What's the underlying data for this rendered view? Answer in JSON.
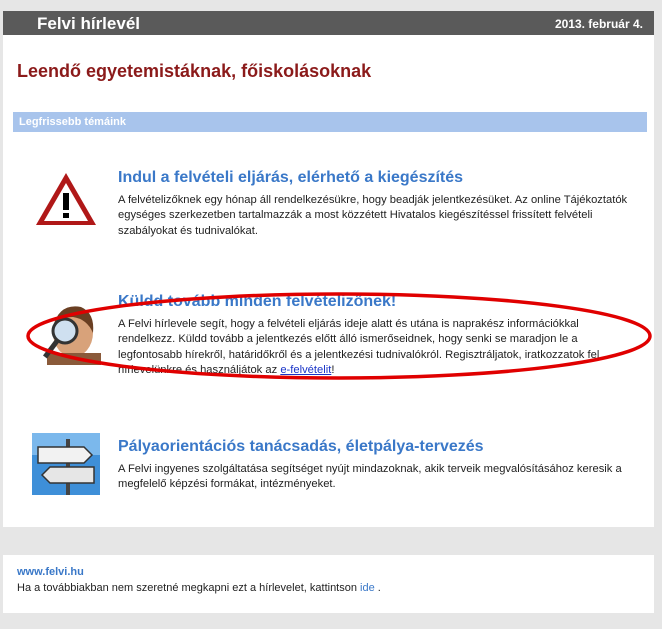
{
  "header": {
    "title": "Felvi hírlevél",
    "date": "2013. február 4."
  },
  "subtitle": "Leendő egyetemistáknak, főiskolásoknak",
  "section_title": "Legfrissebb témáink",
  "articles": [
    {
      "title": "Indul a felvételi eljárás, elérhető a kiegészítés",
      "body": "A felvételizőknek egy hónap áll rendelkezésükre, hogy beadják jelentkezésüket. Az online Tájékoztatók egységes szerkezetben tartalmazzák a most közzétett Hivatalos kiegészítéssel frissített felvételi szabályokat és tudnivalókat.",
      "icon": "warning-icon"
    },
    {
      "title": "Küldd tovább minden felvételizőnek!",
      "body": "A Felvi hírlevele segít, hogy a felvételi eljárás ideje alatt és utána is naprakész információkkal rendelkezz. Küldd tovább a jelentkezés előtt álló ismerőseidnek, hogy senki se maradjon le a legfontosabb hírekről, határidőkről és a jelentkezési tudnivalókról. Regisztráljatok, iratkozzatok fel hírlevelünkre és használjátok az ",
      "link": "e-felvételit",
      "after": "!",
      "icon": "magnifier-person-icon"
    },
    {
      "title": "Pályaorientációs tanácsadás, életpálya-tervezés",
      "body": "A Felvi ingyenes szolgáltatása segítséget nyújt mindazoknak, akik terveik megvalósításához keresik a megfelelő képzési formákat, intézményeket.",
      "icon": "signpost-icon"
    }
  ],
  "footer": {
    "url": "www.felvi.hu",
    "unsubscribe_text": "Ha a továbbiakban nem szeretné megkapni ezt a hírlevelet, kattintson ",
    "unsubscribe_link": "ide",
    "unsubscribe_after": " ."
  },
  "colors": {
    "header_bg": "#5a5a5a",
    "subtitle": "#8b1a1a",
    "section_bar": "#a8c4ec",
    "article_title": "#3a78c8",
    "annotation": "#e00000"
  }
}
